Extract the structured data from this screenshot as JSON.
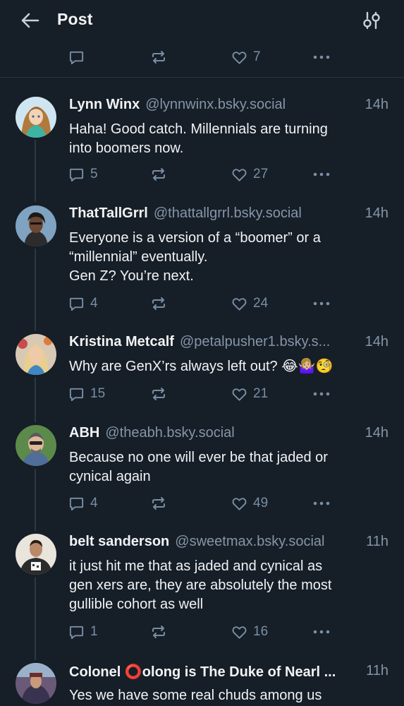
{
  "header": {
    "title": "Post"
  },
  "top_actions": {
    "like_count": "7"
  },
  "posts": [
    {
      "name": "Lynn Winx",
      "handle": "@lynnwinx.bsky.social",
      "time": "14h",
      "text": "Haha! Good catch. Millennials are turning\ninto boomers now.",
      "replies": "5",
      "likes": "27"
    },
    {
      "name": "ThatTallGrrl",
      "handle": "@thattallgrrl.bsky.social",
      "time": "14h",
      "text": "Everyone is a version of a “boomer” or a\n“millennial” eventually.\nGen Z? You’re next.",
      "replies": "4",
      "likes": "24"
    },
    {
      "name": "Kristina Metcalf",
      "handle": "@petalpusher1.bsky.s...",
      "time": "14h",
      "text": "Why are GenX’rs always left out? 😂🤷🏼‍♀️🧐",
      "replies": "15",
      "likes": "21"
    },
    {
      "name": "ABH",
      "handle": "@theabh.bsky.social",
      "time": "14h",
      "text": "Because no one will ever be that jaded or\ncynical again",
      "replies": "4",
      "likes": "49"
    },
    {
      "name": "belt sanderson",
      "handle": "@sweetmax.bsky.social",
      "time": "11h",
      "text": "it just hit me that as jaded and cynical as\ngen xers are, they are absolutely the most\ngullible cohort as well",
      "replies": "1",
      "likes": "16"
    },
    {
      "name": "Colonel ⭕olong is The Duke of Nearl ...",
      "handle": "",
      "time": "11h",
      "text": "Yes we have some real chuds among us"
    }
  ],
  "icons": {
    "back": "arrow-left-icon",
    "filter": "sliders-icon",
    "reply": "speech-bubble-icon",
    "repost": "repost-arrows-icon",
    "like": "heart-icon",
    "more": "ellipsis-icon"
  },
  "colors": {
    "background": "#161e27",
    "text": "#f1f3f5",
    "muted": "#8595a8",
    "icon": "#788ea5",
    "thread_line": "#2b3846"
  }
}
